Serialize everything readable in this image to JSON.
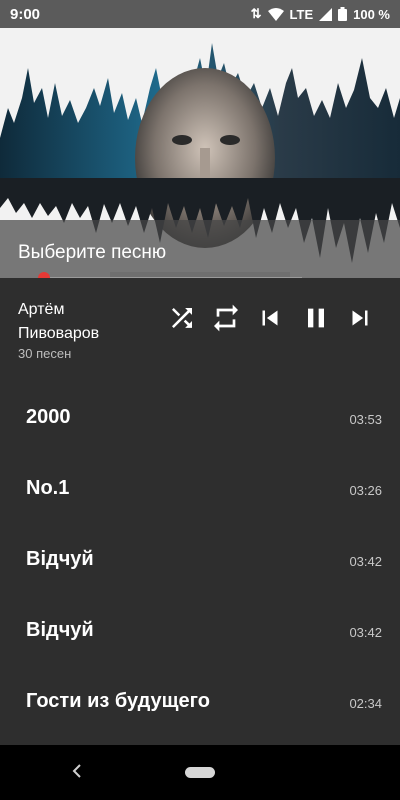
{
  "status": {
    "time": "9:00",
    "network": "LTE",
    "battery": "100 %"
  },
  "cover": {
    "prompt": "Выберите песню",
    "progress": 0.0
  },
  "player": {
    "artist": "Артём Пивоваров",
    "track_count": "30 песен",
    "controls": [
      "shuffle-icon",
      "repeat-icon",
      "skip-previous-icon",
      "pause-icon",
      "skip-next-icon"
    ]
  },
  "tracks": [
    {
      "title": "2000",
      "duration": "03:53"
    },
    {
      "title": "No.1",
      "duration": "03:26"
    },
    {
      "title": "Відчуй",
      "duration": "03:42"
    },
    {
      "title": "Відчуй",
      "duration": "03:42"
    },
    {
      "title": "Гости из будущего",
      "duration": "02:34"
    }
  ],
  "colors": {
    "accent": "#e53935",
    "background": "#2e2e2e",
    "statusbar": "#5b5b5b"
  }
}
